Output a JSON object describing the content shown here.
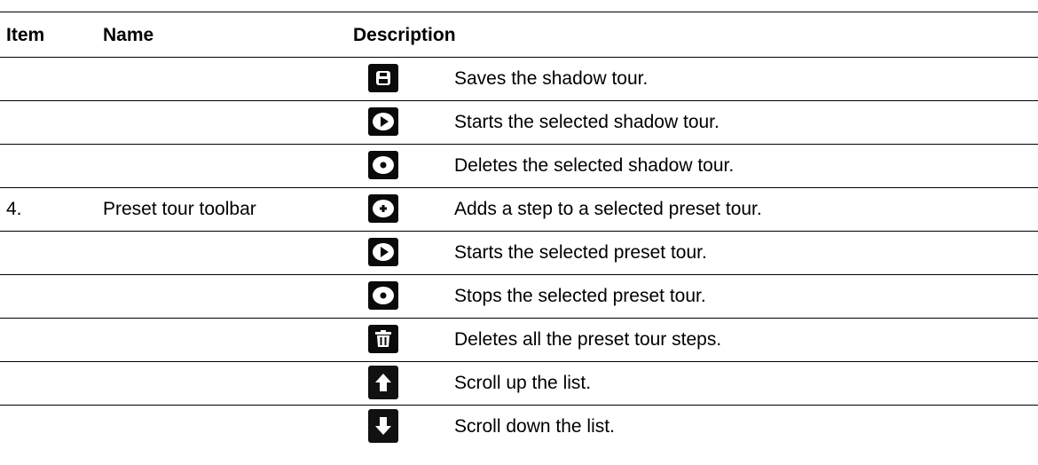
{
  "header": {
    "item": "Item",
    "name": "Name",
    "description": "Description"
  },
  "rows": [
    {
      "item": "",
      "name": "",
      "icon": "save-icon",
      "description": "Saves the shadow tour."
    },
    {
      "item": "",
      "name": "",
      "icon": "play-icon",
      "description": "Starts the selected shadow tour."
    },
    {
      "item": "",
      "name": "",
      "icon": "stop-icon",
      "description": "Deletes the selected shadow tour."
    },
    {
      "item": "4.",
      "name": "Preset tour toolbar",
      "icon": "add-step-icon",
      "description": "Adds a step to a selected preset tour."
    },
    {
      "item": "",
      "name": "",
      "icon": "play-icon",
      "description": "Starts the selected preset tour."
    },
    {
      "item": "",
      "name": "",
      "icon": "stop-icon",
      "description": "Stops the selected preset tour."
    },
    {
      "item": "",
      "name": "",
      "icon": "trash-icon",
      "description": "Deletes all the preset tour steps."
    },
    {
      "item": "",
      "name": "",
      "icon": "arrow-up-icon",
      "description": "Scroll up the list."
    },
    {
      "item": "",
      "name": "",
      "icon": "arrow-down-icon",
      "description": "Scroll down the list."
    }
  ]
}
